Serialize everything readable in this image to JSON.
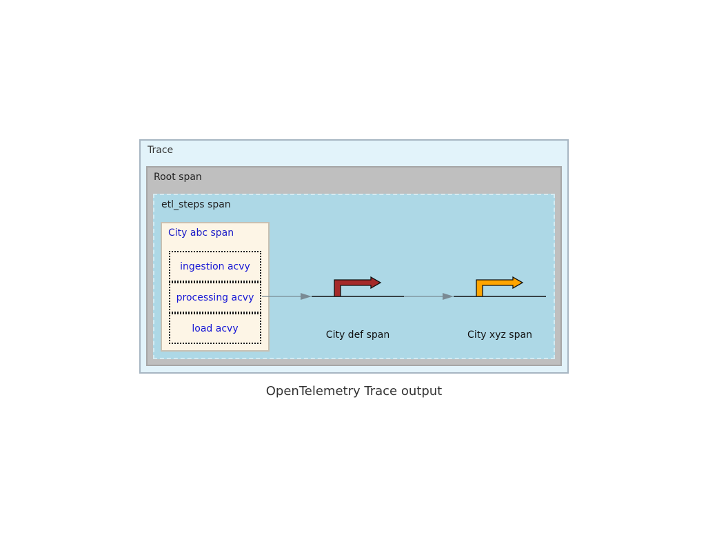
{
  "diagram": {
    "trace_label": "Trace",
    "root_span_label": "Root span",
    "etl_steps_label": "etl_steps span",
    "city_abc": {
      "label": "City abc span",
      "activities": [
        "ingestion acvy",
        "processing acvy",
        "load acvy"
      ]
    },
    "city_def": {
      "label": "City def span",
      "arrow_color": "#a52a2a"
    },
    "city_xyz": {
      "label": "City xyz span",
      "arrow_color": "#ffa500"
    },
    "colors": {
      "trace_bg": "#e2f3fa",
      "root_bg": "#bfbfbf",
      "etl_bg": "#add8e6",
      "abc_bg": "#fdf5e6",
      "connector": "#7a8a94"
    }
  },
  "caption": "OpenTelemetry Trace output"
}
